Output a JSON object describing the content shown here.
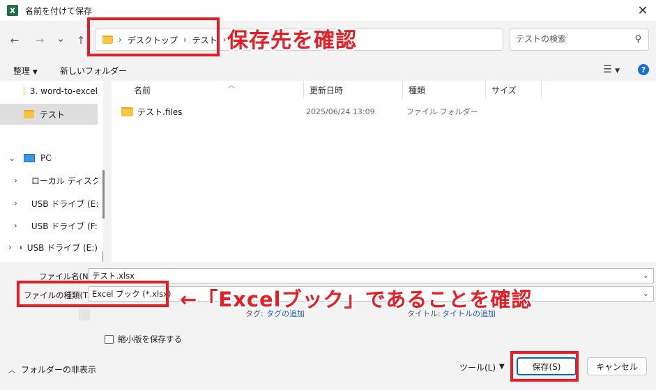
{
  "window": {
    "title": "名前を付けて保存",
    "app_icon_letter": "X",
    "close_glyph": "✕"
  },
  "nav": {
    "back_glyph": "←",
    "forward_glyph": "→",
    "recent_glyph": "⌄",
    "up_glyph": "↑",
    "breadcrumb": [
      "デスクトップ",
      "テスト"
    ],
    "breadcrumb_sep": "›",
    "search_placeholder": "テストの検索"
  },
  "toolbar": {
    "organize_label": "整理",
    "new_folder_label": "新しいフォルダー",
    "help_glyph": "?"
  },
  "sidebar": {
    "items": [
      {
        "label": "3. word-to-excel",
        "icon": "folder-icon",
        "expander": ""
      },
      {
        "label": "テスト",
        "icon": "folder-icon",
        "expander": "",
        "selected": true
      },
      {
        "label": "PC",
        "icon": "pc-icon",
        "expander": "⌄"
      },
      {
        "label": "ローカル ディスク (C:)",
        "icon": "local-disk-icon",
        "expander": "›"
      },
      {
        "label": "USB ドライブ (E:)",
        "icon": "drive-icon",
        "expander": "›"
      },
      {
        "label": "USB ドライブ (F:)",
        "icon": "drive-icon",
        "expander": "›"
      },
      {
        "label": "USB ドライブ (E:)",
        "icon": "drive-icon",
        "expander": "›"
      }
    ]
  },
  "filelist": {
    "columns": [
      "名前",
      "更新日時",
      "種類",
      "サイズ"
    ],
    "rows": [
      {
        "name": "テスト.files",
        "modified": "2025/06/24 13:09",
        "type": "ファイル フォルダー",
        "size": ""
      }
    ]
  },
  "form": {
    "filename_label": "ファイル名(N):",
    "filename_value": "テスト.xlsx",
    "filetype_label": "ファイルの種類(T):",
    "filetype_value": "Excel ブック (*.xlsx)",
    "tags_label": "タグ:",
    "tags_link": "タグの追加",
    "title_label": "タイトル:",
    "title_link": "タイトルの追加",
    "thumbnail_label": "縮小版を保存する"
  },
  "footer": {
    "hide_folders_label": "フォルダーの非表示",
    "tools_label": "ツール(L)",
    "save_label": "保存(S)",
    "cancel_label": "キャンセル"
  },
  "annotations": {
    "destination_note": "保存先を確認",
    "filetype_note": "←「Excelブック」であることを確認"
  },
  "colors": {
    "annotation_red": "#e51e25",
    "accent_blue": "#0067c0"
  }
}
